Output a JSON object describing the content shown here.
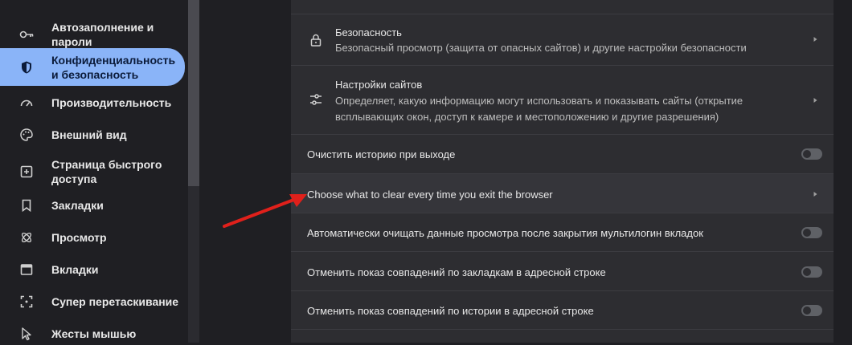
{
  "sidebar": {
    "items": [
      {
        "label": "Автозаполнение и пароли",
        "icon": "key-icon"
      },
      {
        "label": "Конфиденциальность и безопасность",
        "icon": "shield-icon",
        "active": true
      },
      {
        "label": "Производительность",
        "icon": "speedometer-icon"
      },
      {
        "label": "Внешний вид",
        "icon": "palette-icon"
      },
      {
        "label": "Страница быстрого доступа",
        "icon": "speed-dial-icon"
      },
      {
        "label": "Закладки",
        "icon": "bookmark-icon"
      },
      {
        "label": "Просмотр",
        "icon": "atom-icon"
      },
      {
        "label": "Вкладки",
        "icon": "tabs-icon"
      },
      {
        "label": "Супер перетаскивание",
        "icon": "drag-icon"
      },
      {
        "label": "Жесты мышью",
        "icon": "cursor-icon"
      }
    ]
  },
  "main": {
    "security": {
      "title": "Безопасность",
      "subtitle": "Безопасный просмотр (защита от опасных сайтов) и другие настройки безопасности"
    },
    "site_settings": {
      "title": "Настройки сайтов",
      "subtitle": "Определяет, какую информацию могут использовать и показывать сайты (открытие всплывающих окон, доступ к камере и местоположению и другие разрешения)"
    },
    "clear_on_exit": {
      "label": "Очистить историю при выходе",
      "enabled": false
    },
    "choose_clear": {
      "label": "Choose what to clear every time you exit the browser"
    },
    "auto_clear": {
      "label": "Автоматически очищать данные просмотра после закрытия мультилогин вкладок",
      "enabled": false
    },
    "hide_bookmarks": {
      "label": "Отменить показ совпадений по закладкам в адресной строке",
      "enabled": false
    },
    "hide_history": {
      "label": "Отменить показ совпадений по истории в адресной строке",
      "enabled": false
    }
  },
  "colors": {
    "accent": "#8ab4f8",
    "annotation_arrow": "#e0201b"
  }
}
